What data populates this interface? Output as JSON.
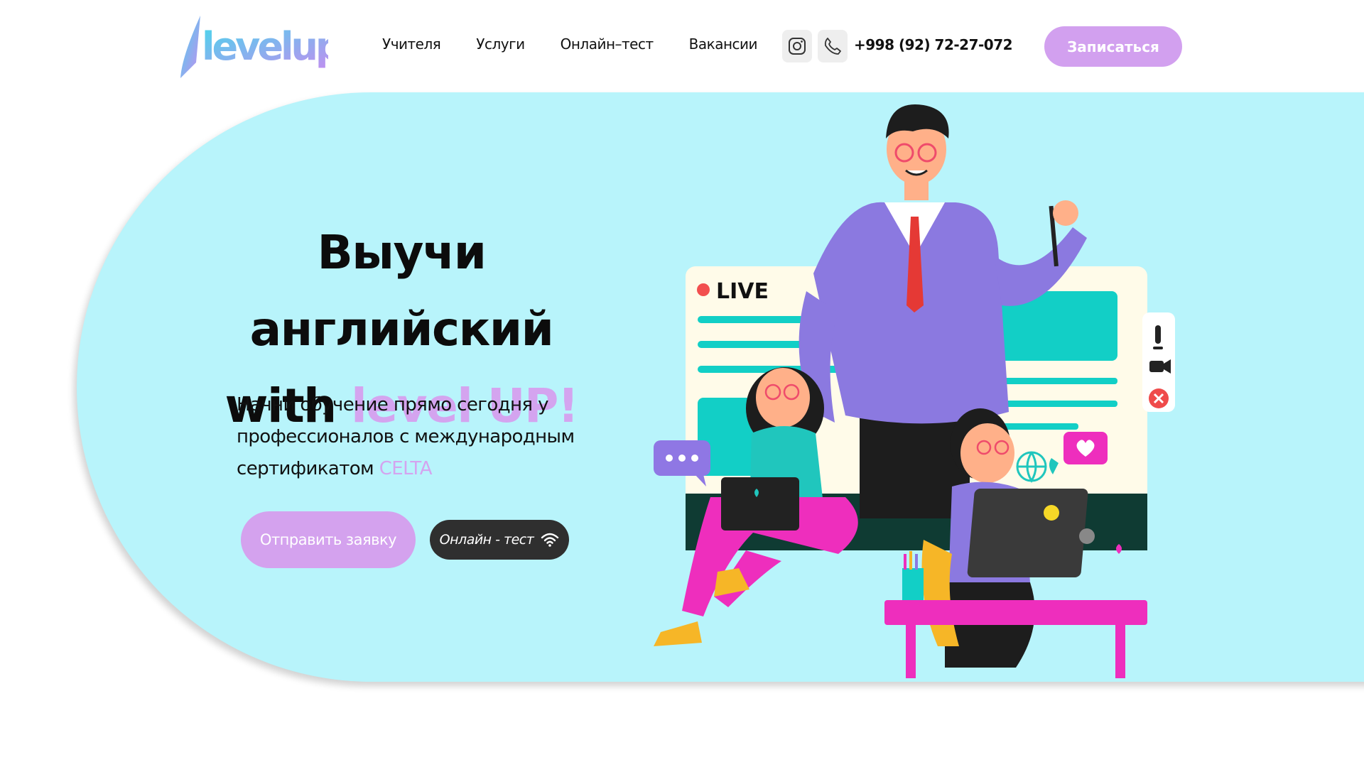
{
  "header": {
    "logo_text": "levelup",
    "nav": [
      "Учителя",
      "Услуги",
      "Онлайн–тест",
      "Вакансии"
    ],
    "phone": "+998 (92) 72-27-072",
    "signup_label": "Записаться",
    "social_icons": [
      "instagram-icon",
      "phone-icon"
    ]
  },
  "hero": {
    "title_line1": "Выучи английский",
    "title_with": "with",
    "title_accent": "level UP!",
    "text_main": "Начни обучение прямо сегодня у профессионалов с международным сертификатом",
    "text_accent": "CELTA",
    "send_button": "Отправить заявку",
    "test_button": "Онлайн - тест",
    "illustration_live_label": "LIVE"
  },
  "colors": {
    "hero_bg": "#b8f4fb",
    "accent": "#d4a4ef",
    "dark_button": "#2f2f2f"
  }
}
